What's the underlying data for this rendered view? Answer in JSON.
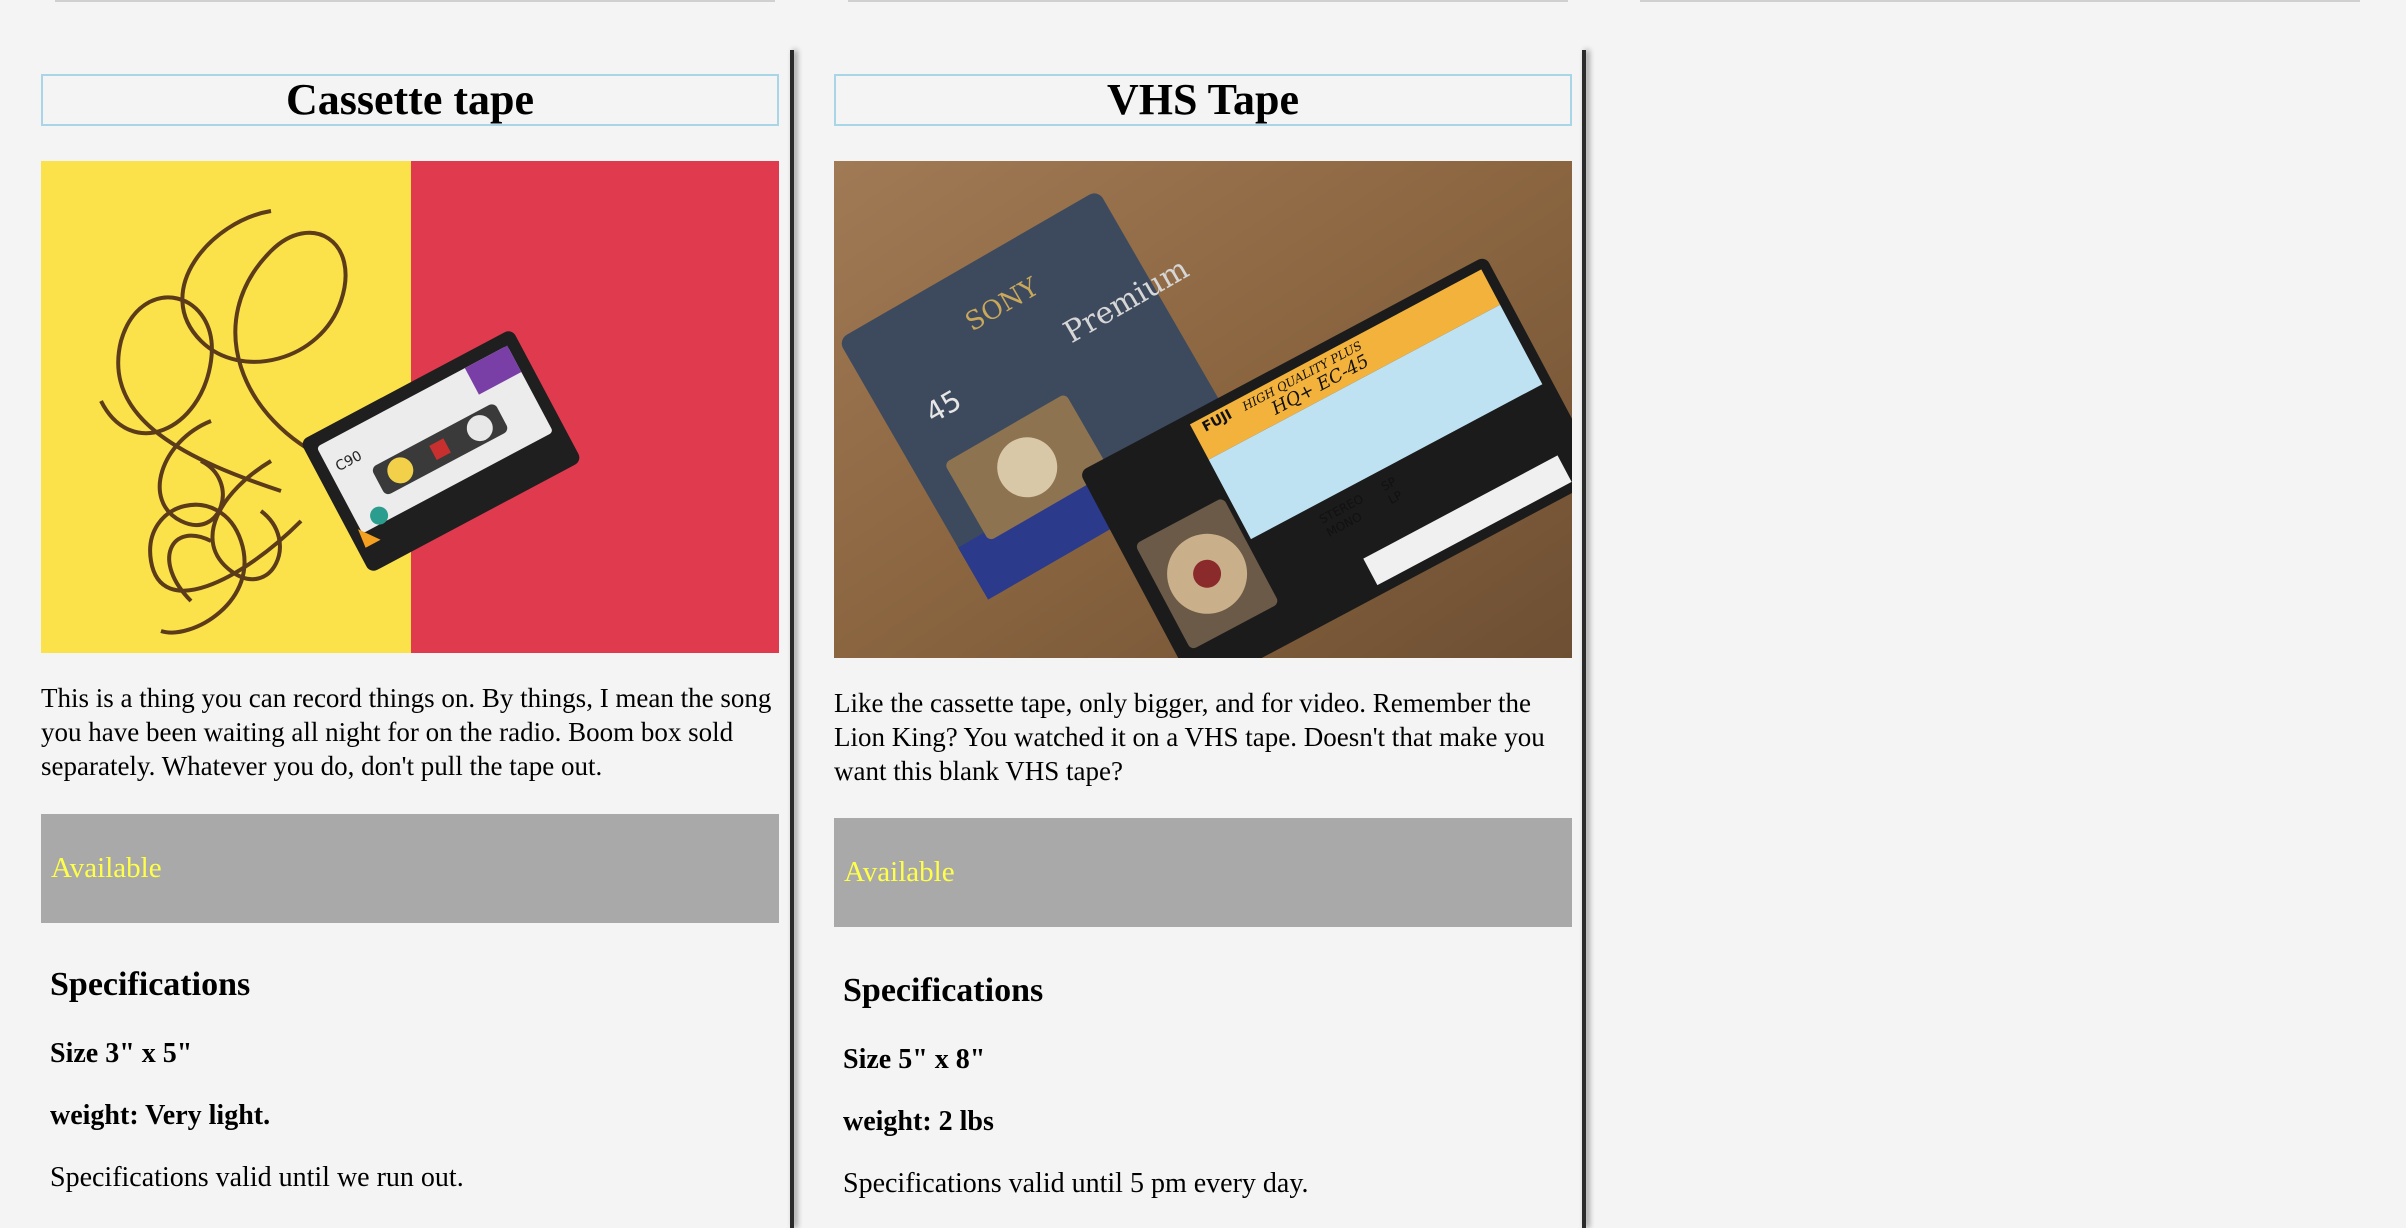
{
  "products": [
    {
      "title": "Cassette tape",
      "image_subject": "cassette tape on yellow and red background",
      "description": "This is a thing you can record things on. By things, I mean the song you have been waiting all night for on the radio. Boom box sold separately. Whatever you do, don't pull the tape out.",
      "availability": "Available",
      "spec_heading": "Specifications",
      "size": "Size 3\" x 5\"",
      "weight": "weight: Very light.",
      "validity": "Specifications valid until we run out.",
      "cassette_label": "C90"
    },
    {
      "title": "VHS Tape",
      "image_subject": "two VHS tapes on wooden table",
      "description": "Like the cassette tape, only bigger, and for video. Remember the Lion King? You watched it on a VHS tape. Doesn't that make you want this blank VHS tape?",
      "availability": "Available",
      "spec_heading": "Specifications",
      "size": "Size 5\" x 8\"",
      "weight": "weight: 2 lbs",
      "validity": "Specifications valid until 5 pm every day.",
      "tape1_brand": "SONY",
      "tape1_model": "Premium",
      "tape1_length": "45",
      "tape2_brand": "FUJI",
      "tape2_line": "HIGH QUALITY PLUS",
      "tape2_model": "HQ+ EC-45",
      "tape2_option_stereo": "STEREO",
      "tape2_option_mono": "MONO",
      "tape2_option_sp": "SP",
      "tape2_option_lp": "LP"
    }
  ],
  "colors": {
    "availability_bg": "#a9a9a9",
    "availability_text": "#ffff4a",
    "title_border": "#a9d6e6",
    "page_bg": "#f4f4f4"
  }
}
